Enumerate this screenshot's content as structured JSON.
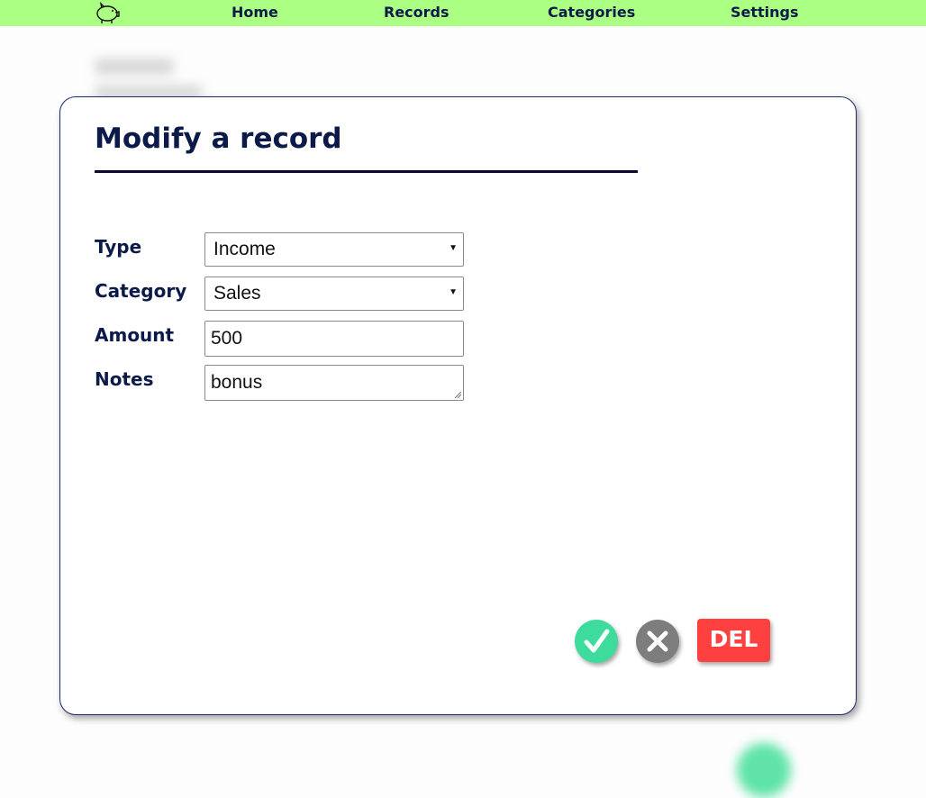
{
  "nav": {
    "logo_icon": "piggy-bank-icon",
    "items": [
      {
        "label": "Home"
      },
      {
        "label": "Records"
      },
      {
        "label": "Categories"
      },
      {
        "label": "Settings"
      }
    ]
  },
  "modal": {
    "title": "Modify a record",
    "fields": {
      "type": {
        "label": "Type",
        "value": "Income"
      },
      "category": {
        "label": "Category",
        "value": "Sales"
      },
      "amount": {
        "label": "Amount",
        "value": "500"
      },
      "notes": {
        "label": "Notes",
        "value": "bonus"
      }
    },
    "actions": {
      "confirm_icon": "check-icon",
      "cancel_icon": "close-icon",
      "delete_label": "DEL"
    }
  },
  "colors": {
    "nav_bg": "#abff82",
    "accent_dark": "#0c1a4a",
    "confirm": "#3ddc9c",
    "cancel": "#7d7d7d",
    "delete": "#ff4040"
  }
}
